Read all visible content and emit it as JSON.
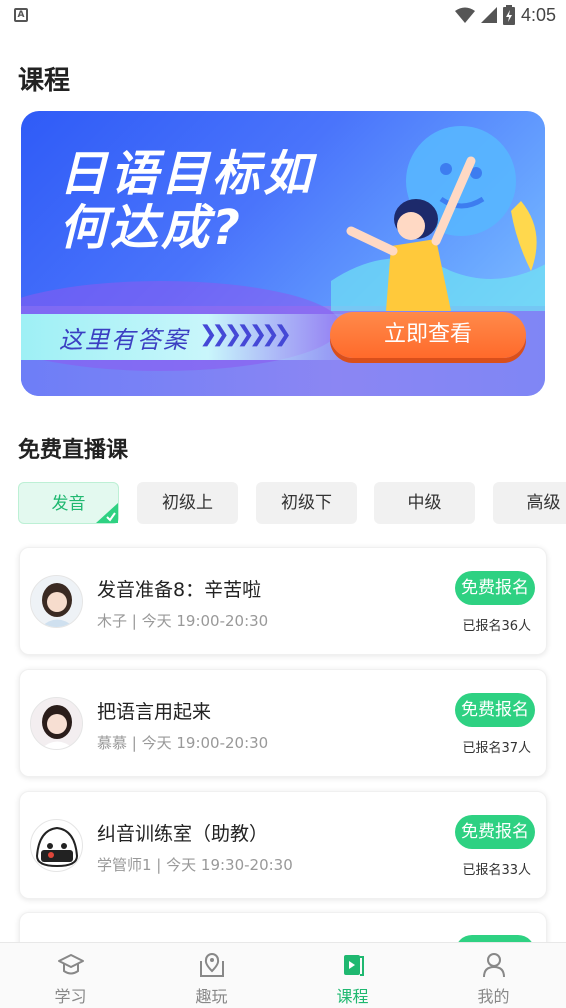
{
  "status_bar": {
    "time": "4:05",
    "app_badge": "A",
    "icons": [
      "wifi-icon",
      "cell-signal-icon",
      "battery-icon"
    ]
  },
  "page": {
    "title": "课程"
  },
  "banner": {
    "headline": "日语目标如何达成?",
    "strip_text": "这里有答案",
    "chevrons": "❯❯❯❯❯❯❯",
    "cta_label": "立即查看",
    "colors": {
      "cta": "#ff6a2b",
      "bg_start": "#2f5bf7",
      "bg_end": "#8ec9ff"
    }
  },
  "live_courses": {
    "section_title": "免费直播课",
    "tabs": [
      {
        "label": "发音",
        "active": true
      },
      {
        "label": "初级上",
        "active": false
      },
      {
        "label": "初级下",
        "active": false
      },
      {
        "label": "中级",
        "active": false
      },
      {
        "label": "高级",
        "active": false
      }
    ],
    "courses": [
      {
        "title": "发音准备8：辛苦啦",
        "teacher": "木子",
        "time": "今天 19:00-20:30",
        "subtitle": "木子 | 今天 19:00-20:30",
        "button": "免费报名",
        "enrolled": "已报名36人",
        "avatar": "teacher-avatar"
      },
      {
        "title": "把语言用起来",
        "teacher": "慕慕",
        "time": "今天 19:00-20:30",
        "subtitle": "慕慕 | 今天 19:00-20:30",
        "button": "免费报名",
        "enrolled": "已报名37人",
        "avatar": "teacher-avatar"
      },
      {
        "title": "纠音训练室（助教）",
        "teacher": "学管师1",
        "time": "今天 19:30-20:30",
        "subtitle": "学管师1 | 今天 19:30-20:30",
        "button": "免费报名",
        "enrolled": "已报名33人",
        "avatar": "rice-ball-avatar"
      }
    ],
    "accent_color": "#2ed182"
  },
  "bottom_nav": {
    "items": [
      {
        "label": "学习",
        "icon": "graduation-cap-icon",
        "active": false
      },
      {
        "label": "趣玩",
        "icon": "map-pin-icon",
        "active": false
      },
      {
        "label": "课程",
        "icon": "video-book-icon",
        "active": true
      },
      {
        "label": "我的",
        "icon": "user-icon",
        "active": false
      }
    ],
    "active_color": "#1fb870"
  }
}
